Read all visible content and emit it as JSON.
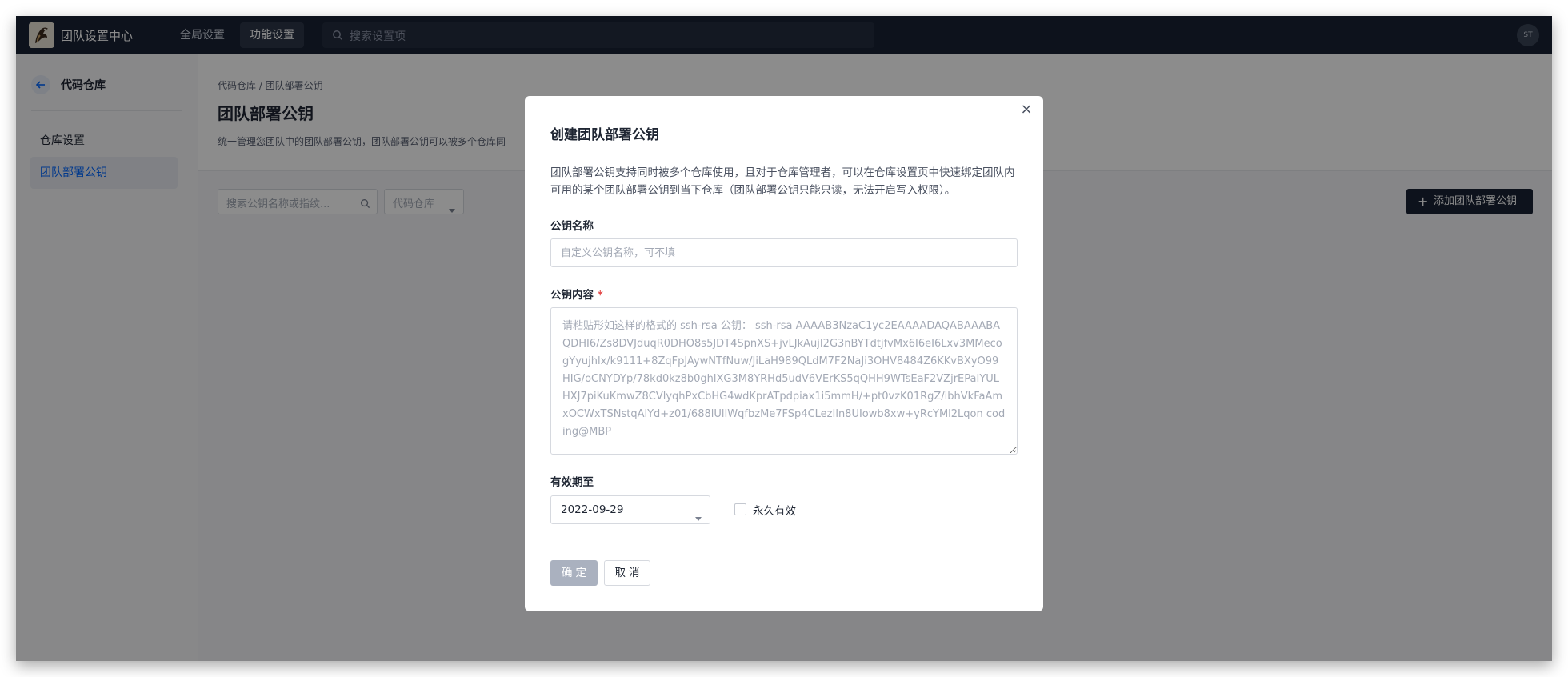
{
  "topbar": {
    "brand_name": "团队设置中心",
    "nav": [
      {
        "label": "全局设置",
        "active": false
      },
      {
        "label": "功能设置",
        "active": true
      }
    ],
    "search_placeholder": "搜索设置项",
    "avatar_initials": "ST",
    "logo_icon": "bird-logo"
  },
  "sidebar": {
    "title": "代码仓库",
    "items": [
      {
        "label": "仓库设置",
        "active": false
      },
      {
        "label": "团队部署公钥",
        "active": true
      }
    ]
  },
  "content": {
    "breadcrumb": "代码仓库 / 团队部署公钥",
    "title": "团队部署公钥",
    "description": "统一管理您团队中的团队部署公钥，团队部署公钥可以被多个仓库同",
    "filter_placeholder": "搜索公钥名称或指纹...",
    "repo_select_label": "代码仓库",
    "add_button_label": "添加团队部署公钥"
  },
  "modal": {
    "title": "创建团队部署公钥",
    "description": "团队部署公钥支持同时被多个仓库使用，且对于仓库管理者，可以在仓库设置页中快速绑定团队内可用的某个团队部署公钥到当下仓库（团队部署公钥只能只读，无法开启写入权限）。",
    "name_label": "公钥名称",
    "name_placeholder": "自定义公钥名称，可不填",
    "content_label": "公钥内容",
    "content_required_mark": "*",
    "content_placeholder": "请粘贴形如这样的格式的 ssh-rsa 公钥： ssh-rsa AAAAB3NzaC1yc2EAAAADAQABAAABAQDHI6/Zs8DVJduqR0DHO8s5JDT4SpnXS+jvLJkAujI2G3nBYTdtjfvMx6I6eI6Lxv3MMecogYyujhlx/k9111+8ZqFpJAywNTfNuw/JiLaH989QLdM7F2NaJi3OHV8484Z6KKvBXyO99HIG/oCNYDYp/78kd0kz8b0ghlXG3M8YRHd5udV6VErKS5qQHH9WTsEaF2VZjrEPaIYULHXJ7piKuKmwZ8CVlyqhPxCbHG4wdKprATpdpiax1i5mmH/+pt0vzK01RgZ/ibhVkFaAmxOCWxTSNstqAlYd+z01/688lUlIWqfbzMe7FSp4CLezIln8UIowb8xw+yRcYMl2Lqon coding@MBP",
    "expire_label": "有效期至",
    "expire_value": "2022-09-29",
    "forever_label": "永久有效",
    "forever_checked": false,
    "confirm_label": "确定",
    "cancel_label": "取消",
    "close_icon": "close-icon"
  },
  "colors": {
    "topbar_bg": "#192233",
    "accent": "#0066ff",
    "required": "#e34b4b",
    "confirm_disabled": "#aab1bf"
  }
}
